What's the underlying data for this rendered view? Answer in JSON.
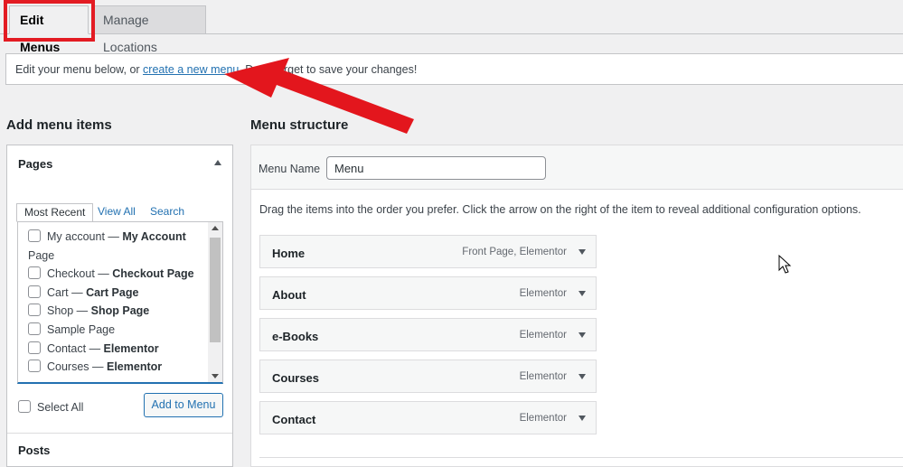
{
  "tabs": {
    "edit_label": "Edit Menus",
    "manage_label": "Manage Locations"
  },
  "notice": {
    "text_before": "Edit your menu below, or ",
    "link": "create a new menu",
    "text_after": ". Don't forget to save your changes!"
  },
  "add_items": {
    "heading": "Add menu items",
    "pages_panel": {
      "title": "Pages",
      "tabs": [
        "Most Recent",
        "View All",
        "Search"
      ],
      "items": [
        {
          "label": "My account",
          "sep": " — ",
          "state": "My Account"
        },
        {
          "label": "Page",
          "sep": "",
          "state": ""
        },
        {
          "label": "Checkout",
          "sep": " — ",
          "state": "Checkout Page"
        },
        {
          "label": "Cart",
          "sep": " — ",
          "state": "Cart Page"
        },
        {
          "label": "Shop",
          "sep": " — ",
          "state": "Shop Page"
        },
        {
          "label": "Sample Page",
          "sep": "",
          "state": ""
        },
        {
          "label": "Contact",
          "sep": " — ",
          "state": "Elementor"
        },
        {
          "label": "Courses",
          "sep": " — ",
          "state": "Elementor"
        }
      ],
      "select_all": "Select All",
      "add_button": "Add to Menu"
    },
    "posts_panel": {
      "title": "Posts"
    }
  },
  "menu_structure": {
    "heading": "Menu structure",
    "name_label": "Menu Name",
    "name_value": "Menu",
    "instructions": "Drag the items into the order you prefer. Click the arrow on the right of the item to reveal additional configuration options.",
    "items": [
      {
        "title": "Home",
        "type": "Front Page, Elementor"
      },
      {
        "title": "About",
        "type": "Elementor"
      },
      {
        "title": "e-Books",
        "type": "Elementor"
      },
      {
        "title": "Courses",
        "type": "Elementor"
      },
      {
        "title": "Contact",
        "type": "Elementor"
      }
    ]
  },
  "colors": {
    "accent": "#2271b1",
    "highlight": "#e31b23",
    "background": "#f0f0f1"
  }
}
